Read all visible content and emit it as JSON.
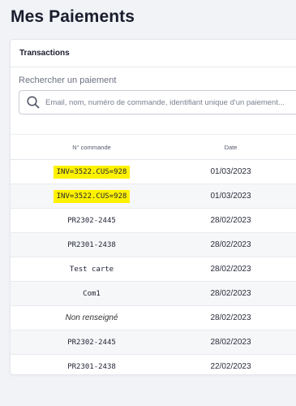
{
  "page": {
    "title": "Mes Paiements"
  },
  "card": {
    "title": "Transactions"
  },
  "search": {
    "label": "Rechercher un paiement",
    "placeholder": "Email, nom, numéro de commande, identifiant unique d'un paiement..."
  },
  "table": {
    "headers": {
      "order": "N° commande",
      "date": "Date"
    },
    "rows": [
      {
        "order": "INV=3522.CUS=928",
        "date": "01/03/2023"
      },
      {
        "order": "INV=3522.CUS=928",
        "date": "01/03/2023"
      },
      {
        "order": "PR2302-2445",
        "date": "28/02/2023"
      },
      {
        "order": "PR2301-2438",
        "date": "28/02/2023"
      },
      {
        "order": "Test carte",
        "date": "28/02/2023"
      },
      {
        "order": "Com1",
        "date": "28/02/2023"
      },
      {
        "order": "Non renseigné",
        "date": "28/02/2023"
      },
      {
        "order": "PR2302-2445",
        "date": "28/02/2023"
      },
      {
        "order": "PR2301-2438",
        "date": "22/02/2023"
      }
    ]
  },
  "colors": {
    "highlight": "#fff200",
    "background": "#f1f3f7",
    "row_alt": "#f6f7f9"
  }
}
